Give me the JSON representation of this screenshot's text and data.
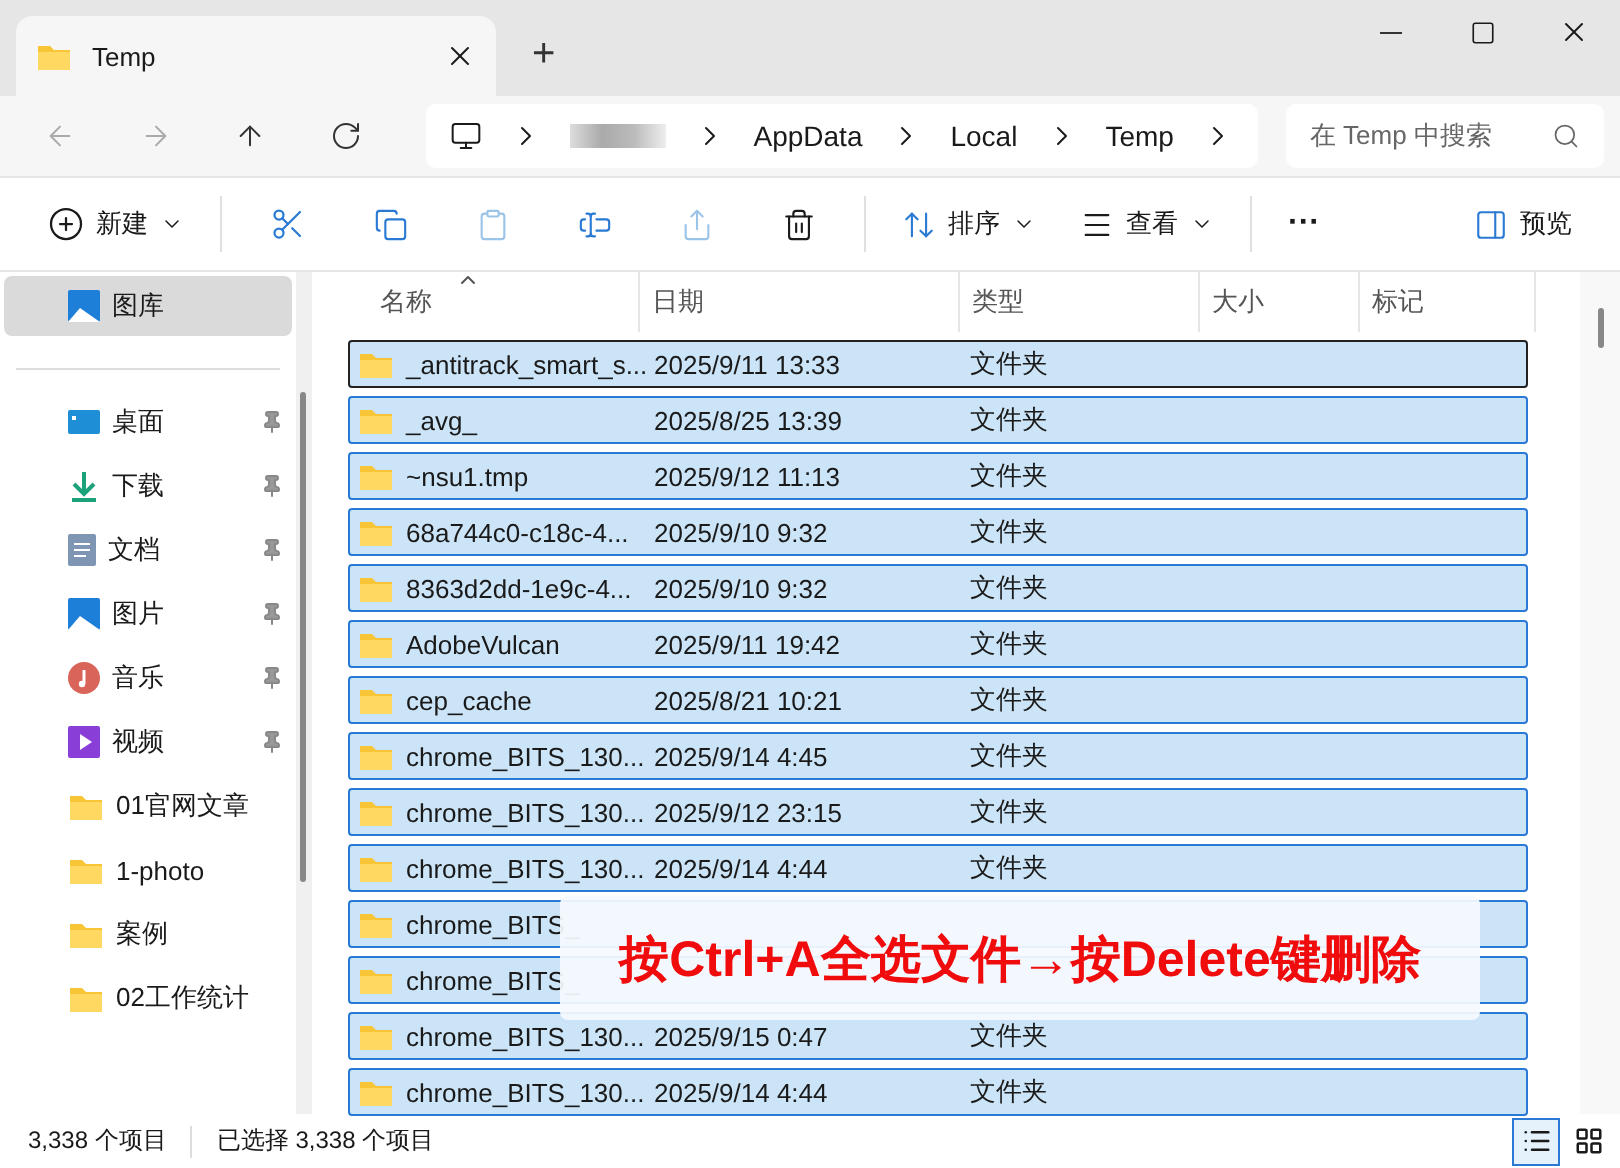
{
  "window": {
    "tab_title": "Temp",
    "new_tab": "+"
  },
  "address": {
    "segments": [
      "AppData",
      "Local",
      "Temp"
    ],
    "search_placeholder": "在 Temp 中搜索"
  },
  "toolbar": {
    "new": "新建",
    "sort": "排序",
    "view": "查看",
    "more": "···",
    "preview": "预览"
  },
  "sidebar": {
    "top": {
      "label": "图库",
      "selected": true
    },
    "items": [
      {
        "label": "桌面",
        "kind": "desktop",
        "pinned": true
      },
      {
        "label": "下载",
        "kind": "download",
        "pinned": true
      },
      {
        "label": "文档",
        "kind": "document",
        "pinned": true
      },
      {
        "label": "图片",
        "kind": "image",
        "pinned": true
      },
      {
        "label": "音乐",
        "kind": "music",
        "pinned": true
      },
      {
        "label": "视频",
        "kind": "video",
        "pinned": true
      },
      {
        "label": "01官网文章",
        "kind": "folder",
        "pinned": false
      },
      {
        "label": "1-photo",
        "kind": "folder",
        "pinned": false
      },
      {
        "label": "案例",
        "kind": "folder",
        "pinned": false
      },
      {
        "label": "02工作统计",
        "kind": "folder",
        "pinned": false
      }
    ]
  },
  "table": {
    "columns": [
      "名称",
      "日期",
      "类型",
      "大小",
      "标记"
    ],
    "rows": [
      {
        "name": "_antitrack_smart_s...",
        "date": "2025/9/11 13:33",
        "type": "文件夹",
        "selected": true,
        "focused": true
      },
      {
        "name": "_avg_",
        "date": "2025/8/25 13:39",
        "type": "文件夹",
        "selected": true,
        "focused": false
      },
      {
        "name": "~nsu1.tmp",
        "date": "2025/9/12 11:13",
        "type": "文件夹",
        "selected": true,
        "focused": false
      },
      {
        "name": "68a744c0-c18c-4...",
        "date": "2025/9/10 9:32",
        "type": "文件夹",
        "selected": true,
        "focused": false
      },
      {
        "name": "8363d2dd-1e9c-4...",
        "date": "2025/9/10 9:32",
        "type": "文件夹",
        "selected": true,
        "focused": false
      },
      {
        "name": "AdobeVulcan",
        "date": "2025/9/11 19:42",
        "type": "文件夹",
        "selected": true,
        "focused": false
      },
      {
        "name": "cep_cache",
        "date": "2025/8/21 10:21",
        "type": "文件夹",
        "selected": true,
        "focused": false
      },
      {
        "name": "chrome_BITS_130...",
        "date": "2025/9/14 4:45",
        "type": "文件夹",
        "selected": true,
        "focused": false
      },
      {
        "name": "chrome_BITS_130...",
        "date": "2025/9/12 23:15",
        "type": "文件夹",
        "selected": true,
        "focused": false
      },
      {
        "name": "chrome_BITS_130...",
        "date": "2025/9/14 4:44",
        "type": "文件夹",
        "selected": true,
        "focused": false
      },
      {
        "name": "chrome_BITS_",
        "selected": true,
        "focused": false
      },
      {
        "name": "chrome_BITS_",
        "selected": true,
        "focused": false
      },
      {
        "name": "chrome_BITS_130...",
        "date": "2025/9/15 0:47",
        "type": "文件夹",
        "selected": true,
        "focused": false
      },
      {
        "name": "chrome_BITS_130...",
        "date": "2025/9/14 4:44",
        "type": "文件夹",
        "selected": true,
        "focused": false
      }
    ]
  },
  "annotation": "按Ctrl+A全选文件→按Delete键删除",
  "status_bar": {
    "count": "3,338 个项目",
    "selection": "已选择 3,338 个项目",
    "view_buttons": [
      {
        "kind": "details",
        "selected": true
      },
      {
        "kind": "tiles",
        "selected": false
      }
    ]
  }
}
